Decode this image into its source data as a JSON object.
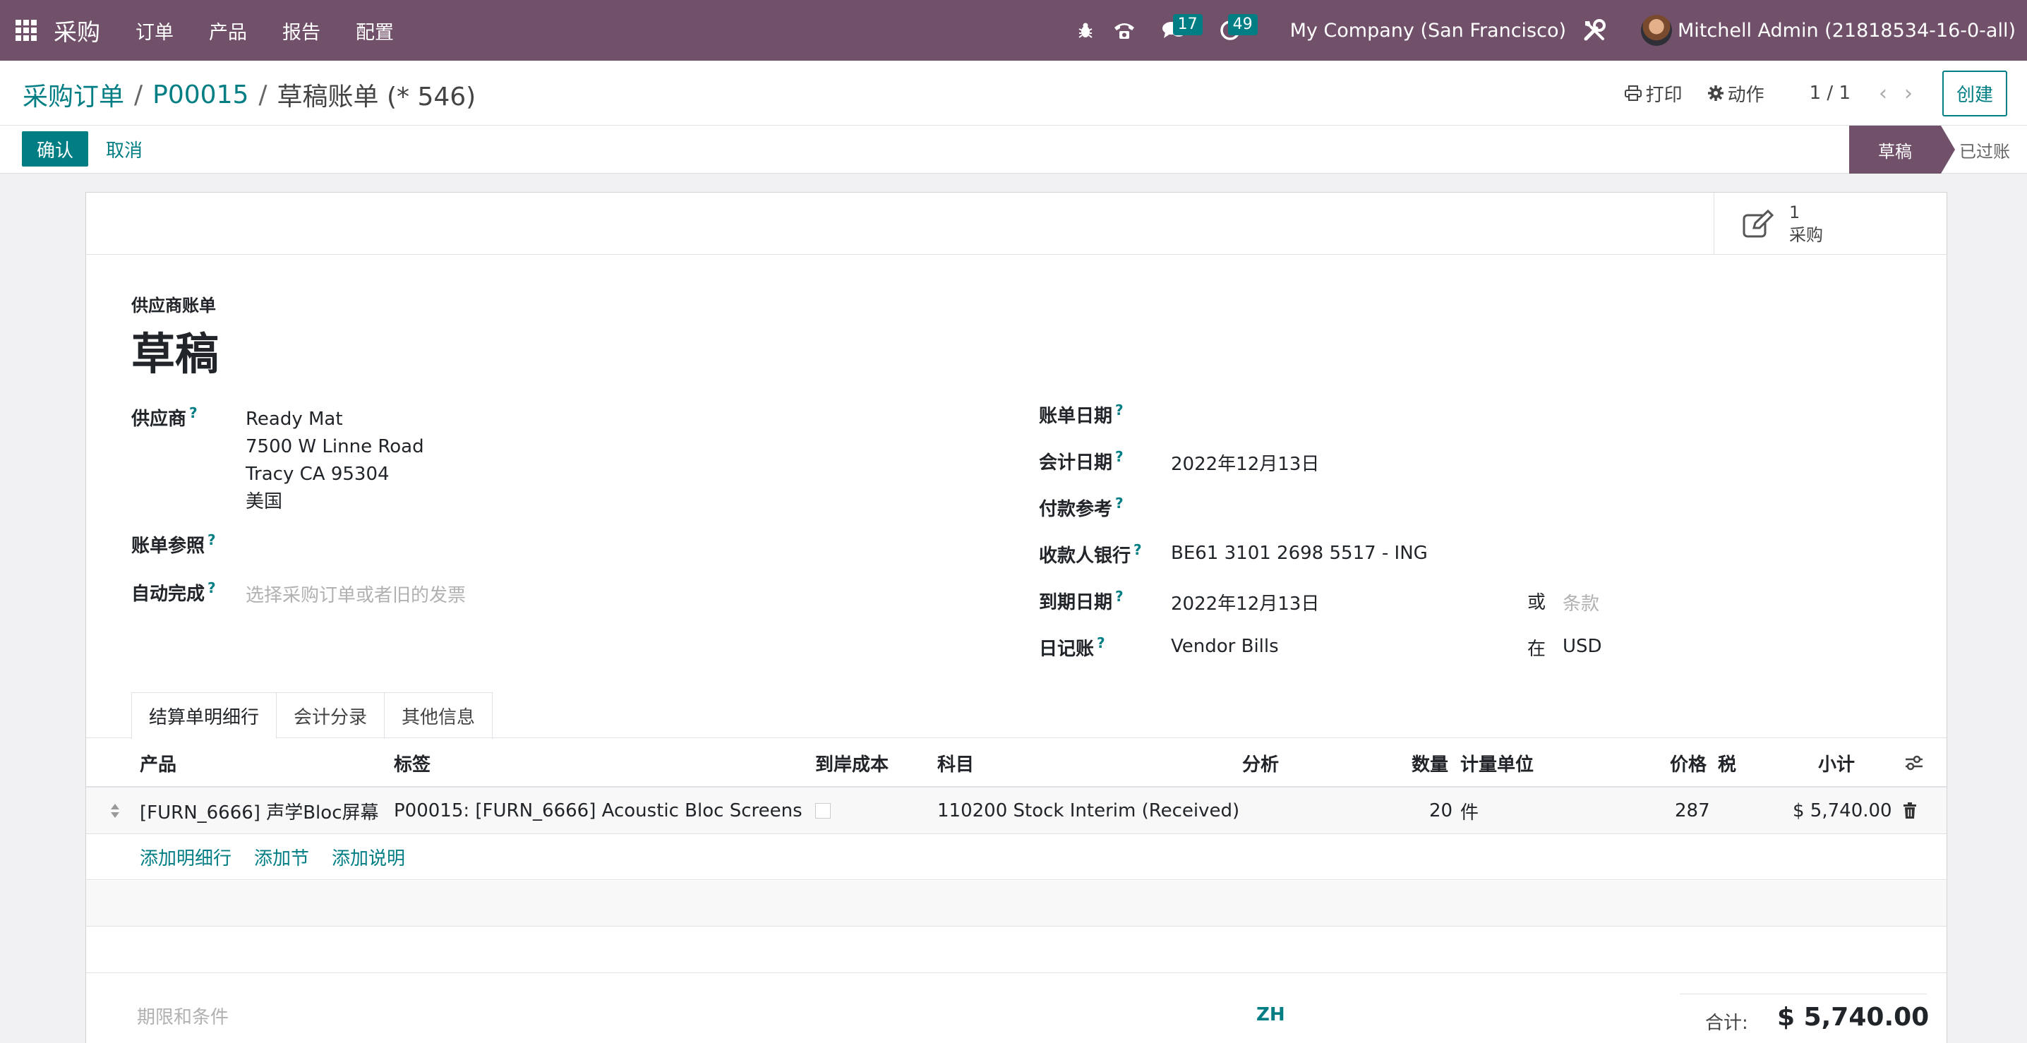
{
  "navbar": {
    "app_name": "采购",
    "menu": [
      "订单",
      "产品",
      "报告",
      "配置"
    ],
    "messages_count": "17",
    "activities_count": "49",
    "company": "My Company (San Francisco)",
    "user": "Mitchell Admin (21818534-16-0-all)"
  },
  "breadcrumb": {
    "items": [
      "采购订单",
      "P00015"
    ],
    "current": "草稿账单 (* 546)"
  },
  "control": {
    "print_label": "打印",
    "action_label": "动作",
    "pager": "1 / 1",
    "create_label": "创建"
  },
  "statusbar": {
    "confirm_label": "确认",
    "cancel_label": "取消",
    "stages": [
      "草稿",
      "已过账"
    ],
    "current_stage": "草稿"
  },
  "smart_button": {
    "count": "1",
    "label": "采购"
  },
  "bill": {
    "type_label": "供应商账单",
    "name": "草稿"
  },
  "left_fields": {
    "vendor_label": "供应商",
    "vendor_lines": [
      "Ready Mat",
      "7500 W Linne Road",
      "Tracy CA 95304",
      "美国"
    ],
    "bill_ref_label": "账单参照",
    "autocomplete_label": "自动完成",
    "autocomplete_placeholder": "选择采购订单或者旧的发票"
  },
  "right_fields": {
    "bill_date_label": "账单日期",
    "accounting_date_label": "会计日期",
    "accounting_date": "2022年12月13日",
    "payment_ref_label": "付款参考",
    "bank_label": "收款人银行",
    "bank": "BE61 3101 2698 5517 - ING",
    "due_date_label": "到期日期",
    "due_date": "2022年12月13日",
    "or_label": "或",
    "terms_placeholder": "条款",
    "journal_label": "日记账",
    "journal": "Vendor Bills",
    "in_label": "在",
    "currency": "USD"
  },
  "tabs": [
    "结算单明细行",
    "会计分录",
    "其他信息"
  ],
  "table": {
    "headers": {
      "product": "产品",
      "label": "标签",
      "landed": "到岸成本",
      "account": "科目",
      "analytic": "分析",
      "qty": "数量",
      "uom": "计量单位",
      "price": "价格",
      "tax": "税",
      "subtotal": "小计"
    },
    "rows": [
      {
        "product": "[FURN_6666] 声学Bloc屏幕",
        "label": "P00015: [FURN_6666] Acoustic Bloc Screens",
        "account": "110200 Stock Interim (Received)",
        "qty": "20",
        "uom": "件",
        "price": "287",
        "subtotal": "$ 5,740.00"
      }
    ],
    "add_line": "添加明细行",
    "add_section": "添加节",
    "add_note": "添加说明"
  },
  "footer": {
    "terms_placeholder": "期限和条件",
    "lang": "ZH",
    "total_label": "合计:",
    "total_value": "$ 5,740.00"
  }
}
